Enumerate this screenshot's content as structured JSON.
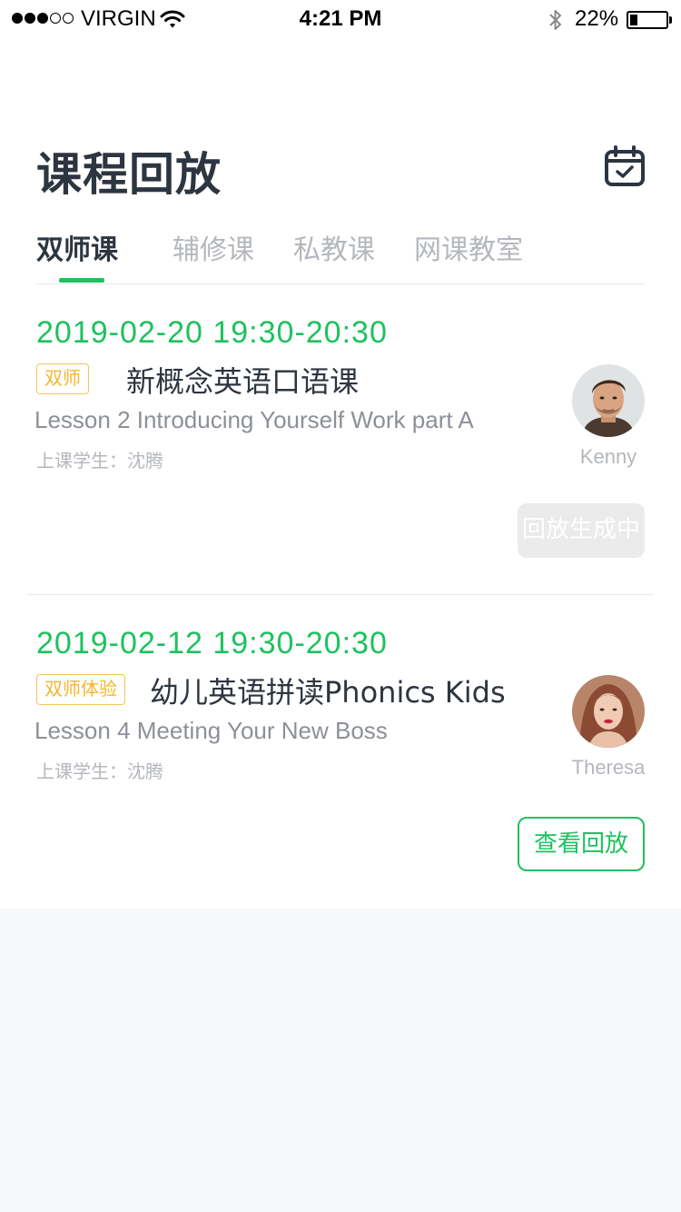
{
  "status_bar": {
    "carrier": "VIRGIN",
    "time": "4:21 PM",
    "battery": "22%",
    "battery_level": 0.22,
    "signal_bars_filled": 3,
    "signal_bars_total": 5
  },
  "header": {
    "title": "课程回放",
    "calendar_icon": "calendar-check-icon"
  },
  "tabs": [
    {
      "label": "双师课",
      "active": true
    },
    {
      "label": "辅修课",
      "active": false
    },
    {
      "label": "私教课",
      "active": false
    },
    {
      "label": "网课教室",
      "active": false
    }
  ],
  "courses": [
    {
      "datetime": "2019-02-20  19:30-20:30",
      "tag": "双师",
      "title": "新概念英语口语课",
      "lesson": "Lesson 2  Introducing Yourself Work part A",
      "students": "上课学生：沈腾",
      "teacher": "Kenny",
      "action": "回放生成中",
      "action_enabled": false
    },
    {
      "datetime": "2019-02-12  19:30-20:30",
      "tag": "双师体验",
      "title": "幼儿英语拼读Phonics Kids",
      "lesson": "Lesson 4  Meeting Your New Boss",
      "students": "上课学生：沈腾",
      "teacher": "Theresa",
      "action": "查看回放",
      "action_enabled": true
    }
  ],
  "colors": {
    "accent": "#1fc15e",
    "tag": "#f5b62e",
    "title_text": "#2d3540",
    "muted_text": "#b4b7bc",
    "page_bg": "#f7f8fa"
  }
}
